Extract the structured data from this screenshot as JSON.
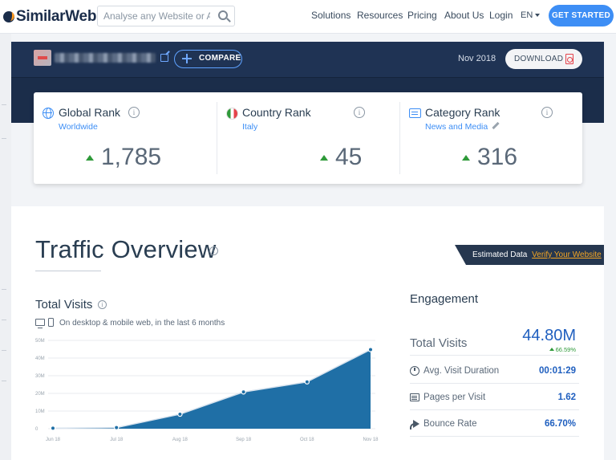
{
  "header": {
    "logo_text": "SimilarWeb",
    "search_placeholder": "Analyse any Website or App",
    "nav": [
      "Solutions",
      "Resources",
      "Pricing",
      "About Us",
      "Login"
    ],
    "language": "EN",
    "cta_label": "GET STARTED"
  },
  "site_bar": {
    "compare_label": "COMPARE",
    "period": "Nov 2018",
    "download_label": "DOWNLOAD"
  },
  "ranks": [
    {
      "title": "Global Rank",
      "subtitle": "Worldwide",
      "value": "1,785",
      "icon": "globe-icon"
    },
    {
      "title": "Country Rank",
      "subtitle": "Italy",
      "value": "45",
      "icon": "italy-flag-icon"
    },
    {
      "title": "Category Rank",
      "subtitle": "News and Media",
      "value": "316",
      "icon": "category-icon"
    }
  ],
  "traffic": {
    "title": "Traffic Overview",
    "estimated_label": "Estimated Data",
    "verify_link": "Verify Your Website"
  },
  "total_visits": {
    "title": "Total Visits",
    "subtitle": "On desktop & mobile web, in the last 6 months"
  },
  "chart_data": {
    "type": "area",
    "categories": [
      "Jun 18",
      "Jul 18",
      "Aug 18",
      "Sep 18",
      "Oct 18",
      "Nov 18"
    ],
    "values": [
      0.3,
      0.6,
      8.2,
      20.8,
      26.5,
      44.8
    ],
    "yticks": [
      "0",
      "10M",
      "20M",
      "30M",
      "40M",
      "50M"
    ],
    "ylim": [
      0,
      50
    ],
    "color": "#1f6fa6"
  },
  "engagement": {
    "title": "Engagement",
    "total_visits_label": "Total Visits",
    "total_visits_value": "44.80M",
    "total_visits_change": "66.59%",
    "rows": [
      {
        "label": "Avg. Visit Duration",
        "value": "00:01:29",
        "icon": "clock-icon"
      },
      {
        "label": "Pages per Visit",
        "value": "1.62",
        "icon": "pages-icon"
      },
      {
        "label": "Bounce Rate",
        "value": "66.70%",
        "icon": "bounce-icon"
      }
    ]
  },
  "colors": {
    "accent": "#3d8ef5",
    "navy": "#1b2d4a",
    "positive": "#2f9a3a"
  }
}
